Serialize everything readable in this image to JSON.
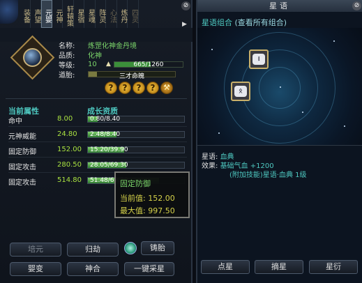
{
  "left_panel": {
    "tabs": [
      {
        "label": "装备",
        "state": "normal"
      },
      {
        "label": "声望",
        "state": "normal"
      },
      {
        "label": "元婴",
        "state": "active"
      },
      {
        "label": "元神",
        "state": "normal"
      },
      {
        "label": "轩辕策",
        "state": "normal"
      },
      {
        "label": "星宿",
        "state": "normal"
      },
      {
        "label": "星魂",
        "state": "normal"
      },
      {
        "label": "阵灵",
        "state": "normal"
      },
      {
        "label": "心法",
        "state": "dim"
      },
      {
        "label": "炼丹",
        "state": "normal"
      },
      {
        "label": "四灵",
        "state": "dim"
      }
    ],
    "item": {
      "name_label": "名称:",
      "name": "炼罡化神金丹境",
      "quality_label": "品质:",
      "quality": "化神",
      "level_label": "等级:",
      "level": "10",
      "xp_text": "665/1260",
      "xp_fraction": 0.53,
      "taitai_label": "道胎:",
      "taitai_text": "三才命魄",
      "taitai_fraction": 0.1
    },
    "attr_header": "当前属性",
    "growth_header": "成长资质",
    "attributes": [
      {
        "name": "命中",
        "value": "8.00",
        "growth_text": "0.80/8.40",
        "growth_fraction": 0.1
      },
      {
        "name": "元神威能",
        "value": "24.80",
        "growth_text": "2.48/8.40",
        "growth_fraction": 0.3
      },
      {
        "name": "固定防御",
        "value": "152.00",
        "growth_text": "15.20/39.90",
        "growth_fraction": 0.38
      },
      {
        "name": "固定攻击",
        "value": "280.50",
        "growth_text": "28.05/69.30",
        "growth_fraction": 0.4
      },
      {
        "name": "固定攻击",
        "value": "514.80",
        "growth_text": "51.48/69.30",
        "growth_fraction": 0.74
      }
    ],
    "tooltip": {
      "title": "固定防御",
      "current_label": "当前值:",
      "current_value": "152.00",
      "max_label": "最大值:",
      "max_value": "997.50"
    },
    "buttons": {
      "peiyuan": "培元",
      "guijie": "归劫",
      "zhutai": "铸胎",
      "yingbian": "婴变",
      "shenhe": "神合",
      "yijiancaixing": "一键采星"
    }
  },
  "right_panel": {
    "title": "星语",
    "combo_label": "星语组合",
    "combo_link": "(查看所有组合)",
    "nodes": [
      {
        "glyph": "᎒"
      },
      {
        "glyph": "ᛟ"
      }
    ],
    "info": {
      "xingyu_label": "星语:",
      "xingyu_value": "血典",
      "effect_label": "效果:",
      "effect_line1": "基础气血 +1200",
      "effect_line2": "(附加技能)星语·血典 1级"
    },
    "buttons": {
      "dianxing": "点星",
      "zhaixing": "摘星",
      "xingxing": "星衍"
    }
  }
}
